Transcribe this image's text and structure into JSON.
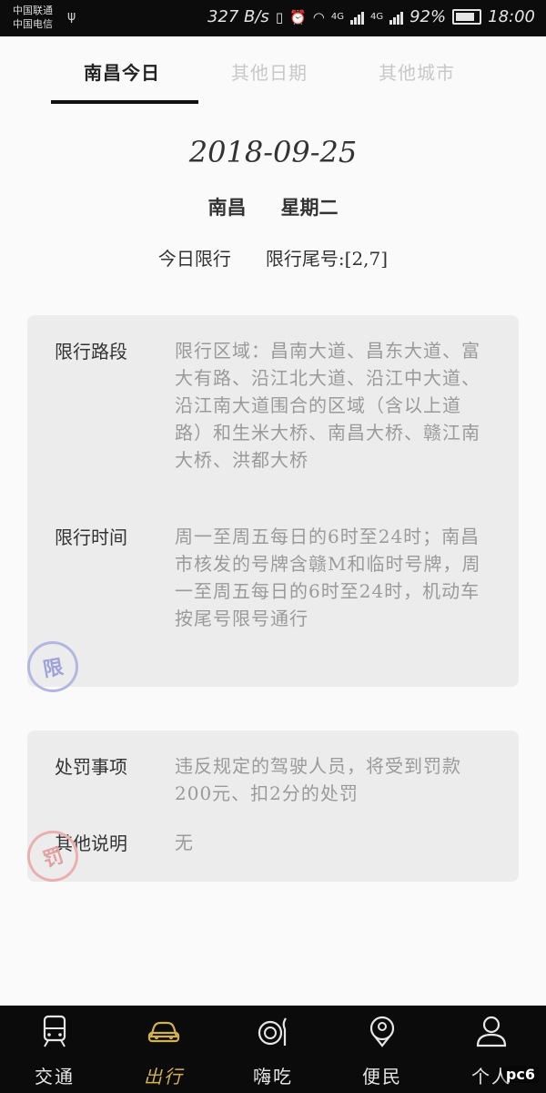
{
  "status_bar": {
    "carrier1": "中国联通",
    "carrier2": "中国电信",
    "speed": "327 B/s",
    "network1": "4G",
    "network2": "4G",
    "battery": "92%",
    "time": "18:00"
  },
  "tabs": [
    {
      "label": "南昌今日",
      "active": true
    },
    {
      "label": "其他日期",
      "active": false
    },
    {
      "label": "其他城市",
      "active": false
    }
  ],
  "summary": {
    "date": "2018-09-25",
    "city": "南昌",
    "weekday": "星期二",
    "today_limit": "今日限行",
    "tail_numbers": "限行尾号:[2,7]"
  },
  "limit_card": {
    "roads_label": "限行路段",
    "roads_text": "限行区域：昌南大道、昌东大道、富大有路、沿江北大道、沿江中大道、沿江南大道围合的区域（含以上道路）和生米大桥、南昌大桥、赣江南大桥、洪都大桥",
    "time_label": "限行时间",
    "time_text": "周一至周五每日的6时至24时；南昌市核发的号牌含赣M和临时号牌，周一至周五每日的6时至24时，机动车按尾号限号通行",
    "stamp": "限"
  },
  "fine_card": {
    "penalty_label": "处罚事项",
    "penalty_text": "违反规定的驾驶人员，将受到罚款200元、扣2分的处罚",
    "notes_label": "其他说明",
    "notes_text": "无",
    "stamp": "罚"
  },
  "bottom_nav": [
    {
      "label": "交通",
      "icon": "train-icon",
      "active": false
    },
    {
      "label": "出行",
      "icon": "car-icon",
      "active": true
    },
    {
      "label": "嗨吃",
      "icon": "dining-icon",
      "active": false
    },
    {
      "label": "便民",
      "icon": "location-icon",
      "active": false
    },
    {
      "label": "个人",
      "icon": "user-icon",
      "active": false
    }
  ],
  "watermark": "pc6",
  "colors": {
    "accent": "#d4b24a",
    "card_bg": "#ececec",
    "nav_bg": "#0b0b0b"
  }
}
